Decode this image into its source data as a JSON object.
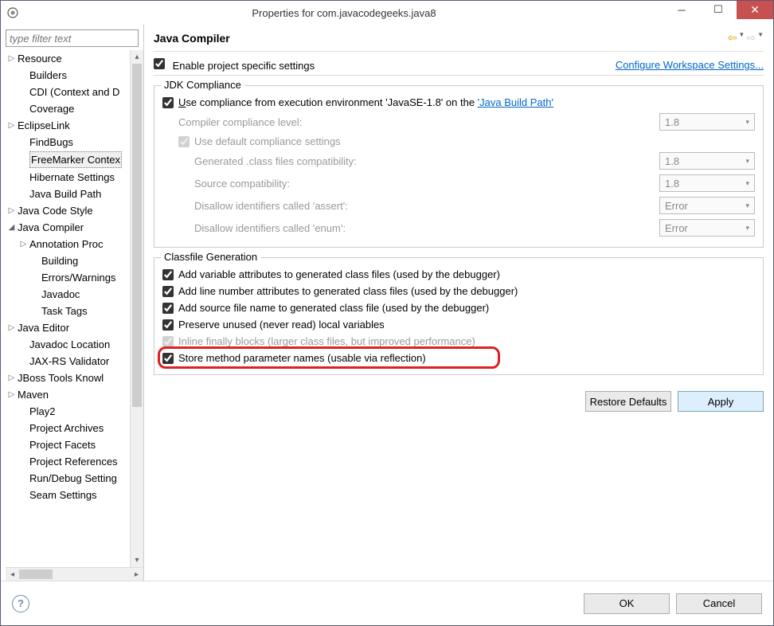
{
  "window": {
    "title": "Properties for com.javacodegeeks.java8"
  },
  "filter": {
    "placeholder": "type filter text"
  },
  "tree": {
    "items": [
      {
        "label": "Resource",
        "indent": 1,
        "arrow": "▷"
      },
      {
        "label": "Builders",
        "indent": 2,
        "arrow": ""
      },
      {
        "label": "CDI (Context and D",
        "indent": 2,
        "arrow": ""
      },
      {
        "label": "Coverage",
        "indent": 2,
        "arrow": ""
      },
      {
        "label": "EclipseLink",
        "indent": 1,
        "arrow": "▷"
      },
      {
        "label": "FindBugs",
        "indent": 2,
        "arrow": ""
      },
      {
        "label": "FreeMarker Contex",
        "indent": 2,
        "arrow": "",
        "selected": true
      },
      {
        "label": "Hibernate Settings",
        "indent": 2,
        "arrow": ""
      },
      {
        "label": "Java Build Path",
        "indent": 2,
        "arrow": ""
      },
      {
        "label": "Java Code Style",
        "indent": 1,
        "arrow": "▷"
      },
      {
        "label": "Java Compiler",
        "indent": 1,
        "arrow": "◢"
      },
      {
        "label": "Annotation Proc",
        "indent": 2,
        "arrow": "▷"
      },
      {
        "label": "Building",
        "indent": 3,
        "arrow": ""
      },
      {
        "label": "Errors/Warnings",
        "indent": 3,
        "arrow": ""
      },
      {
        "label": "Javadoc",
        "indent": 3,
        "arrow": ""
      },
      {
        "label": "Task Tags",
        "indent": 3,
        "arrow": ""
      },
      {
        "label": "Java Editor",
        "indent": 1,
        "arrow": "▷"
      },
      {
        "label": "Javadoc Location",
        "indent": 2,
        "arrow": ""
      },
      {
        "label": "JAX-RS Validator",
        "indent": 2,
        "arrow": ""
      },
      {
        "label": "JBoss Tools Knowl",
        "indent": 1,
        "arrow": "▷"
      },
      {
        "label": "Maven",
        "indent": 1,
        "arrow": "▷"
      },
      {
        "label": "Play2",
        "indent": 2,
        "arrow": ""
      },
      {
        "label": "Project Archives",
        "indent": 2,
        "arrow": ""
      },
      {
        "label": "Project Facets",
        "indent": 2,
        "arrow": ""
      },
      {
        "label": "Project References",
        "indent": 2,
        "arrow": ""
      },
      {
        "label": "Run/Debug Setting",
        "indent": 2,
        "arrow": ""
      },
      {
        "label": "Seam Settings",
        "indent": 2,
        "arrow": ""
      }
    ]
  },
  "page": {
    "title": "Java Compiler",
    "enable_specific": "Enable project specific settings",
    "configure_link": "Configure Workspace Settings..."
  },
  "jdk": {
    "legend": "JDK Compliance",
    "use_env_prefix": "Use compliance from execution environment 'JavaSE-1.8' on the ",
    "use_env_link": "'Java Build Path'",
    "compliance_level_label": "Compiler compliance level:",
    "compliance_level_value": "1.8",
    "use_defaults": "Use default compliance settings",
    "gen_class_label": "Generated .class files compatibility:",
    "gen_class_value": "1.8",
    "source_compat_label": "Source compatibility:",
    "source_compat_value": "1.8",
    "assert_label": "Disallow identifiers called 'assert':",
    "assert_value": "Error",
    "enum_label": "Disallow identifiers called 'enum':",
    "enum_value": "Error"
  },
  "classfile": {
    "legend": "Classfile Generation",
    "var_attrs": "Add variable attributes to generated class files (used by the debugger)",
    "line_attrs": "Add line number attributes to generated class files (used by the debugger)",
    "source_name": "Add source file name to generated class file (used by the debugger)",
    "preserve_unused": "Preserve unused (never read) local variables",
    "inline_finally": "Inline finally blocks (larger class files, but improved performance)",
    "store_params": "Store method parameter names (usable via reflection)"
  },
  "buttons": {
    "restore": "Restore Defaults",
    "apply": "Apply",
    "ok": "OK",
    "cancel": "Cancel"
  }
}
